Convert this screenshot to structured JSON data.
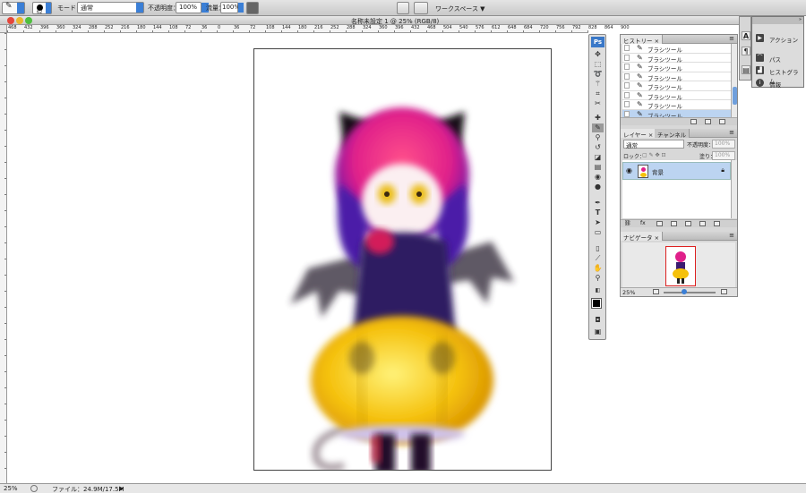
{
  "options_bar": {
    "brush_size": "62",
    "mode_label": "モード：",
    "mode_value": "通常",
    "opacity_label": "不透明度：",
    "opacity_value": "100%",
    "flow_label": "流量：",
    "flow_value": "100%",
    "workspace_label": "ワークスペース ▼"
  },
  "window": {
    "title": "名称未設定 1 @ 25% (RGB/8)"
  },
  "ruler_top": [
    "468",
    "432",
    "396",
    "360",
    "324",
    "288",
    "252",
    "216",
    "180",
    "144",
    "108",
    "72",
    "36",
    "0",
    "36",
    "72",
    "108",
    "144",
    "180",
    "216",
    "252",
    "288",
    "324",
    "360",
    "396",
    "432",
    "468",
    "504",
    "540",
    "576",
    "612",
    "648",
    "684",
    "720",
    "756",
    "792",
    "828",
    "864",
    "900"
  ],
  "toolbox": {
    "logo": "Ps"
  },
  "history_panel": {
    "tab": "ヒストリー",
    "items": [
      "ブラシツール",
      "ブラシツール",
      "ブラシツール",
      "ブラシツール",
      "ブラシツール",
      "ブラシツール",
      "ブラシツール",
      "ブラシツール"
    ],
    "selected_index": 7
  },
  "layers_panel": {
    "tab": "レイヤー",
    "tab2": "チャンネル",
    "blend": "通常",
    "opacity_label": "不透明度：",
    "opacity_value": "100%",
    "lock_label": "ロック：",
    "fill_label": "塗り：",
    "fill_value": "100%",
    "layer_name": "背景"
  },
  "navigator_panel": {
    "tab": "ナビゲータ",
    "zoom": "25%"
  },
  "flyout": {
    "items": [
      "アクション",
      "パス",
      "ヒストグラム",
      "情報"
    ]
  },
  "status_bar": {
    "zoom": "25%",
    "file_info": "ファイル：24.9M/17.5M"
  },
  "colors": {
    "accent": "#3b7fd6",
    "selected_row": "#bcd4f1"
  }
}
